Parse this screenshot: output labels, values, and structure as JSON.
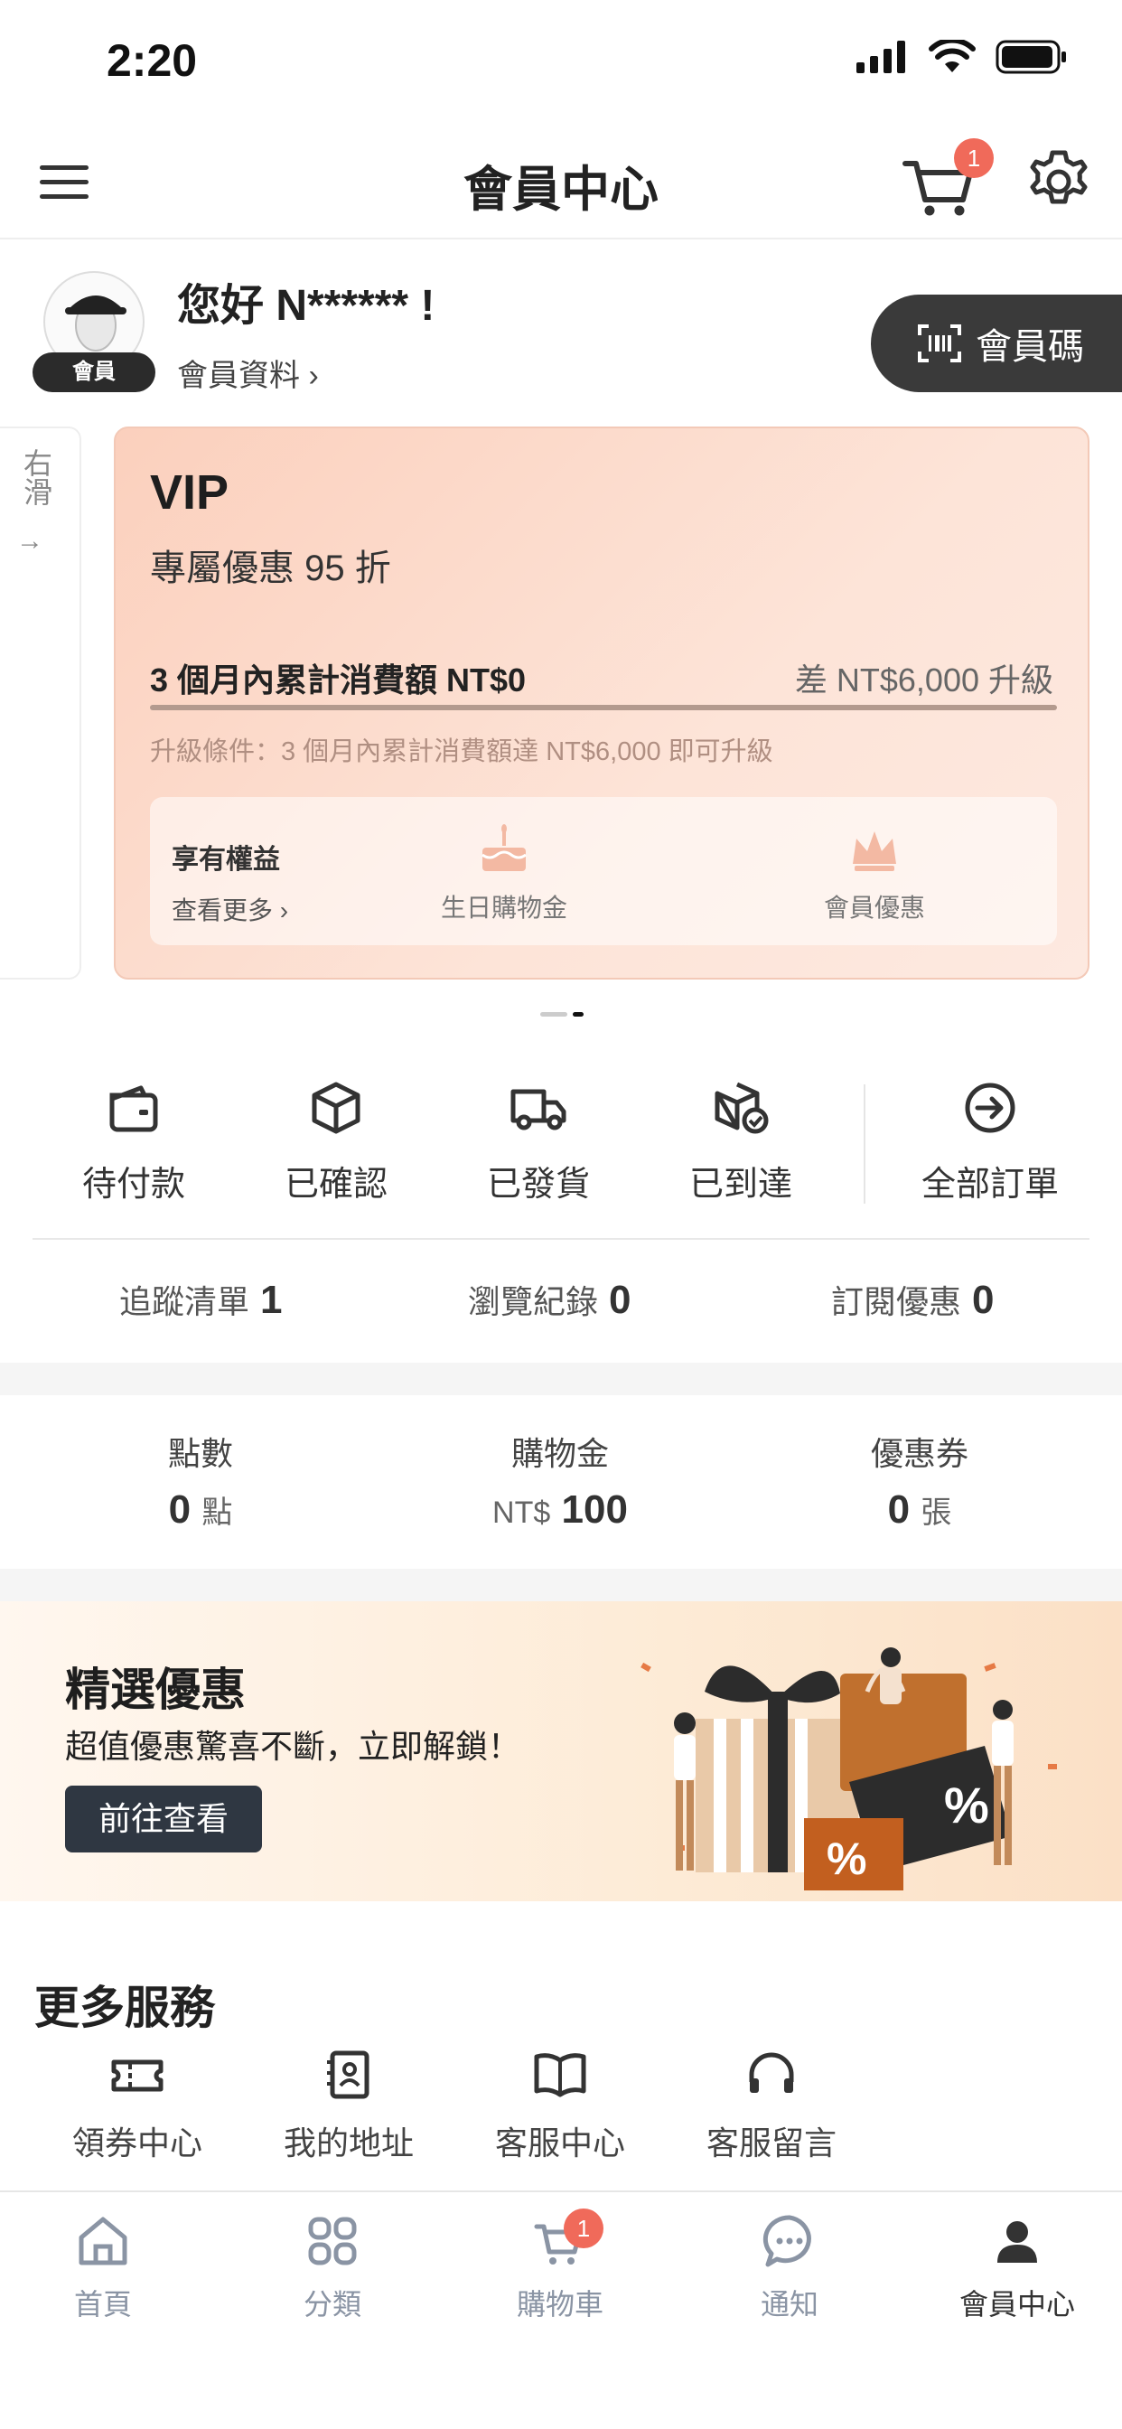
{
  "status_bar": {
    "time": "2:20"
  },
  "header": {
    "title": "會員中心",
    "cart_badge": "1"
  },
  "profile": {
    "greeting": "您好 N****** !",
    "member_tag": "會員",
    "profile_link": "會員資料 ›",
    "member_code_button": "會員碼"
  },
  "swipe_hint": {
    "text": "右滑",
    "arrow": "→"
  },
  "vip_card": {
    "tier": "VIP",
    "discount": "專屬優惠 95 折",
    "accumulated": "3 個月內累計消費額 NT$0",
    "difference": "差 NT$6,000 升級",
    "progress": 0,
    "condition": "升級條件：3 個月內累計消費額達 NT$6,000 即可升級",
    "benefits_title": "享有權益",
    "benefits_more": "查看更多 ›",
    "benefits": [
      {
        "label": "生日購物金",
        "icon": "birthday-cake-icon"
      },
      {
        "label": "會員優惠",
        "icon": "crown-icon"
      }
    ]
  },
  "orders": [
    {
      "label": "待付款",
      "icon": "wallet-icon"
    },
    {
      "label": "已確認",
      "icon": "box-icon"
    },
    {
      "label": "已發貨",
      "icon": "truck-icon"
    },
    {
      "label": "已到達",
      "icon": "box-check-icon"
    },
    {
      "label": "全部訂單",
      "icon": "arrow-circle-icon"
    }
  ],
  "tracking": [
    {
      "label": "追蹤清單",
      "count": "1"
    },
    {
      "label": "瀏覽紀錄",
      "count": "0"
    },
    {
      "label": "訂閱優惠",
      "count": "0"
    }
  ],
  "points": [
    {
      "label": "點數",
      "value": "0",
      "unit": "點",
      "prefix": ""
    },
    {
      "label": "購物金",
      "value": "100",
      "unit": "",
      "prefix": "NT$"
    },
    {
      "label": "優惠券",
      "value": "0",
      "unit": "張",
      "prefix": ""
    }
  ],
  "banner": {
    "title": "精選優惠",
    "subtitle": "超值優惠驚喜不斷，立即解鎖！",
    "button": "前往查看",
    "percent": "%"
  },
  "services": {
    "title": "更多服務",
    "items": [
      {
        "label": "領券中心",
        "icon": "ticket-icon"
      },
      {
        "label": "我的地址",
        "icon": "address-book-icon"
      },
      {
        "label": "客服中心",
        "icon": "book-icon"
      },
      {
        "label": "客服留言",
        "icon": "headset-icon"
      }
    ]
  },
  "tabbar": {
    "items": [
      {
        "label": "首頁",
        "icon": "home-icon"
      },
      {
        "label": "分類",
        "icon": "grid-icon"
      },
      {
        "label": "購物車",
        "icon": "cart-icon",
        "badge": "1"
      },
      {
        "label": "通知",
        "icon": "chat-icon"
      },
      {
        "label": "會員中心",
        "icon": "user-icon",
        "active": true
      }
    ]
  },
  "colors": {
    "accent_badge": "#f06a5a",
    "dark": "#3a3a3a",
    "vip_bg": "#fbd0bd"
  }
}
